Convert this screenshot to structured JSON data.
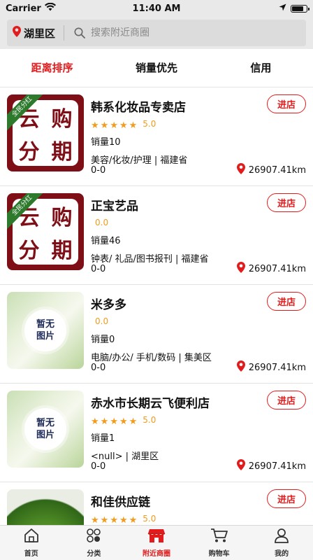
{
  "status_bar": {
    "carrier": "Carrier",
    "time": "11:40 AM",
    "battery_level": 0.9
  },
  "header": {
    "location": "湖里区",
    "search_placeholder": "搜索附近商圈"
  },
  "sort_tabs": [
    {
      "label": "距离排序",
      "active": true
    },
    {
      "label": "销量优先",
      "active": false
    },
    {
      "label": "信用",
      "active": false
    }
  ],
  "brand_logo": {
    "chars": [
      "云",
      "购",
      "分",
      "期"
    ],
    "ribbon": "全民分红"
  },
  "no_image": {
    "line1": "暂无",
    "line2": "图片"
  },
  "stores": [
    {
      "name": "韩系化妆品专卖店",
      "stars": 5,
      "score": "5.0",
      "sales": "销量10",
      "category": "美容/化妆/护理 | 福建省",
      "extra": "0-0",
      "distance": "26907.41km",
      "enter": "进店"
    },
    {
      "name": "正宝艺品",
      "stars": 0,
      "score": "0.0",
      "sales": "销量46",
      "category": "钟表/ 礼品/图书报刊 | 福建省",
      "extra": "0-0",
      "distance": "26907.41km",
      "enter": "进店"
    },
    {
      "name": "米多多",
      "stars": 0,
      "score": "0.0",
      "sales": "销量0",
      "category": "电脑/办公/ 手机/数码 | 集美区",
      "extra": "0-0",
      "distance": "26907.41km",
      "enter": "进店"
    },
    {
      "name": "赤水市长期云飞便利店",
      "stars": 5,
      "score": "5.0",
      "sales": "销量1",
      "category": "<null> | 湖里区",
      "extra": "0-0",
      "distance": "26907.41km",
      "enter": "进店"
    },
    {
      "name": "和佳供应链",
      "stars": 5,
      "score": "5.0",
      "sales": "",
      "category": "",
      "extra": "",
      "distance": "",
      "enter": "进店"
    }
  ],
  "tab_bar": [
    {
      "label": "首页",
      "icon": "home-icon",
      "active": false
    },
    {
      "label": "分类",
      "icon": "category-icon",
      "active": false
    },
    {
      "label": "附近商圈",
      "icon": "nearby-shop-icon",
      "active": true
    },
    {
      "label": "购物车",
      "icon": "cart-icon",
      "active": false
    },
    {
      "label": "我的",
      "icon": "profile-icon",
      "active": false
    }
  ],
  "colors": {
    "accent": "#e21c1c",
    "star": "#f29b1d",
    "brand": "#7e0f17"
  }
}
